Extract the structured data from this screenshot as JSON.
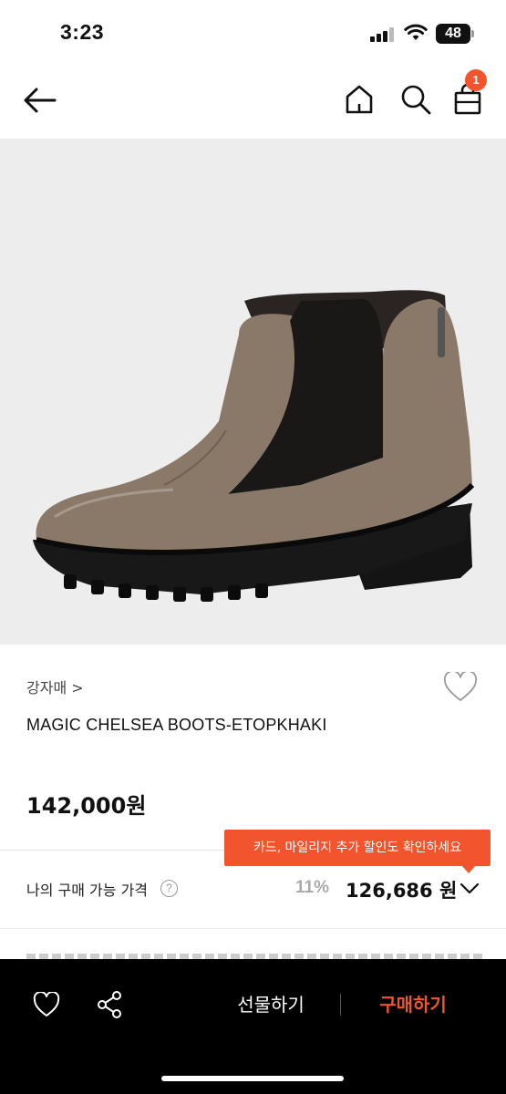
{
  "status_bar": {
    "time": "3:23",
    "battery": "48"
  },
  "nav": {
    "cart_count": "1"
  },
  "product": {
    "brand": "강자매 >",
    "name": "MAGIC CHELSEA BOOTS-ETOPKHAKI",
    "price": "142,000원",
    "image_icon": "chelsea-boot"
  },
  "promo_tooltip": {
    "text": "카드, 마일리지 추가 할인도 확인하세요"
  },
  "purchase_price": {
    "label": "나의 구매 가능 가격",
    "info_symbol": "?",
    "discount_rate": "11%",
    "price": "126,686 원"
  },
  "bottom_bar": {
    "gift_label": "선물하기",
    "buy_label": "구매하기"
  },
  "colors": {
    "accent": "#f2542d",
    "boot_leather": "#8a7968",
    "image_background": "#ededed"
  }
}
